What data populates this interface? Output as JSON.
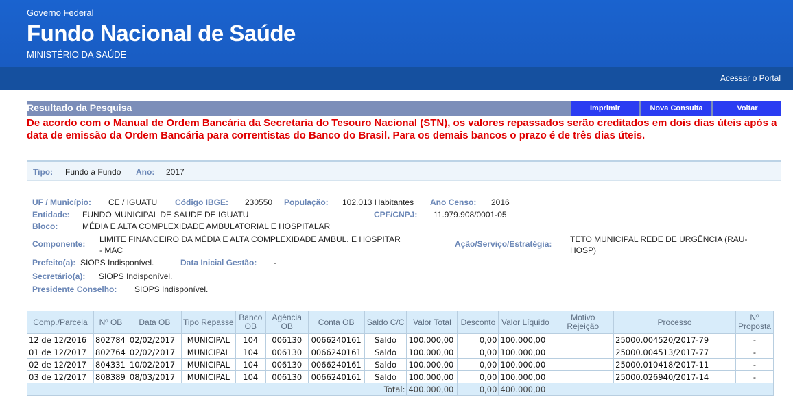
{
  "header": {
    "gov": "Governo Federal",
    "title": "Fundo Nacional de Saúde",
    "ministry": "MINISTÉRIO DA SAÚDE",
    "portal_link": "Acessar o Portal"
  },
  "titlebar": {
    "title": "Resultado da Pesquisa",
    "print": "Imprimir",
    "new_query": "Nova Consulta",
    "back": "Voltar"
  },
  "notice": "De acordo com o Manual de Ordem Bancária da Secretaria do Tesouro Nacional (STN), os valores repassados serão creditados em dois dias úteis após a data de emissão da Ordem Bancária para correntistas do Banco do Brasil. Para os demais bancos o prazo é de três dias úteis.",
  "tipo": {
    "label": "Tipo:",
    "value": "Fundo a Fundo",
    "ano_label": "Ano:",
    "ano_value": "2017"
  },
  "info": {
    "uf_label": "UF / Município:",
    "uf_value": "CE / IGUATU",
    "ibge_label": "Código IBGE:",
    "ibge_value": "230550",
    "pop_label": "População:",
    "pop_value": "102.013 Habitantes",
    "censo_label": "Ano Censo:",
    "censo_value": "2016",
    "entidade_label": "Entidade:",
    "entidade_value": "FUNDO MUNICIPAL DE SAUDE DE IGUATU",
    "cnpj_label": "CPF/CNPJ:",
    "cnpj_value": "11.979.908/0001-05",
    "bloco_label": "Bloco:",
    "bloco_value": "MÉDIA E ALTA COMPLEXIDADE AMBULATORIAL E HOSPITALAR",
    "componente_label": "Componente:",
    "componente_value_1": "LIMITE FINANCEIRO DA MÉDIA E ALTA COMPLEXIDADE AMBUL. E HOSPITAR",
    "componente_value_2": "- MAC",
    "acao_label": "Ação/Serviço/Estratégia:",
    "acao_value_1": "TETO MUNICIPAL REDE DE URGÊNCIA (RAU-",
    "acao_value_2": "HOSP)",
    "prefeito_label": "Prefeito(a):",
    "prefeito_value": "SIOPS Indisponível.",
    "gestao_label": "Data Inicial Gestão:",
    "gestao_value": "-",
    "secretario_label": "Secretário(a):",
    "secretario_value": "SIOPS Indisponível.",
    "presidente_label": "Presidente Conselho:",
    "presidente_value": "SIOPS Indisponível."
  },
  "table": {
    "headers": [
      "Comp./Parcela",
      "Nº OB",
      "Data OB",
      "Tipo Repasse",
      "Banco OB",
      "Agência OB",
      "Conta OB",
      "Saldo C/C",
      "Valor Total",
      "Desconto",
      "Valor Líquido",
      "Motivo Rejeição",
      "Processo",
      "Nº Proposta"
    ],
    "rows": [
      [
        "12 de 12/2016",
        "802784",
        "02/02/2017",
        "MUNICIPAL",
        "104",
        "006130",
        "0066240161",
        "Saldo",
        "100.000,00",
        "0,00",
        "100.000,00",
        "",
        "25000.004520/2017-79",
        "-"
      ],
      [
        "01 de 12/2017",
        "802764",
        "02/02/2017",
        "MUNICIPAL",
        "104",
        "006130",
        "0066240161",
        "Saldo",
        "100.000,00",
        "0,00",
        "100.000,00",
        "",
        "25000.004513/2017-77",
        "-"
      ],
      [
        "02 de 12/2017",
        "804331",
        "10/02/2017",
        "MUNICIPAL",
        "104",
        "006130",
        "0066240161",
        "Saldo",
        "100.000,00",
        "0,00",
        "100.000,00",
        "",
        "25000.010418/2017-11",
        "-"
      ],
      [
        "03 de 12/2017",
        "808389",
        "08/03/2017",
        "MUNICIPAL",
        "104",
        "006130",
        "0066240161",
        "Saldo",
        "100.000,00",
        "0,00",
        "100.000,00",
        "",
        "25000.026940/2017-14",
        "-"
      ]
    ],
    "total_label": "Total:",
    "total_valor": "400.000,00",
    "total_desconto": "0,00",
    "total_liquido": "400.000,00"
  }
}
